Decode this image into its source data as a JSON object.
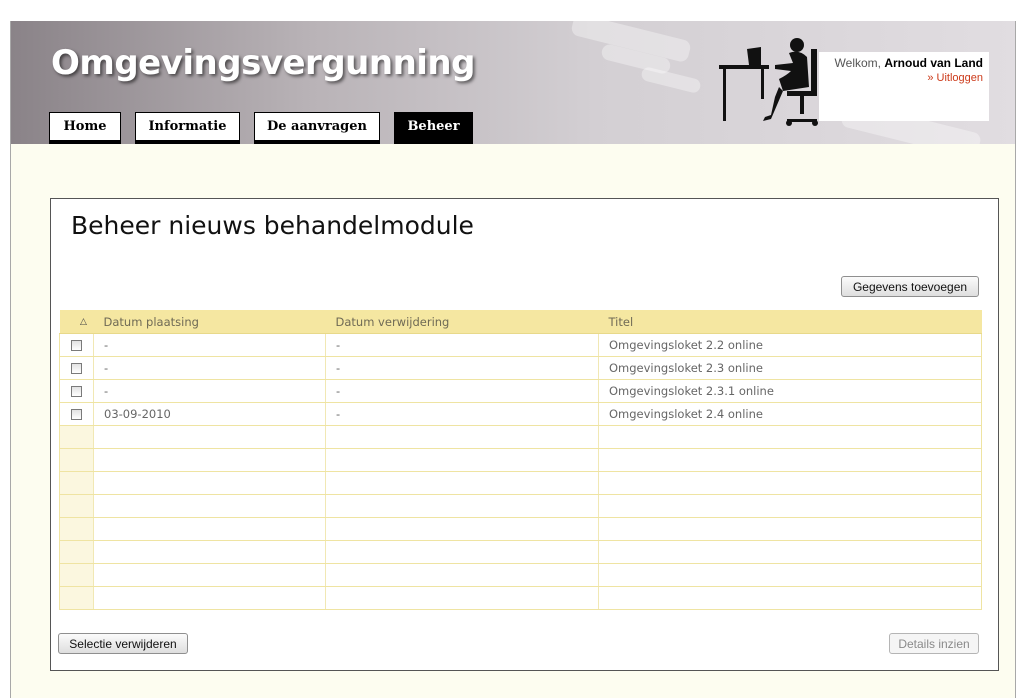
{
  "app": {
    "title": "Omgevingsvergunning"
  },
  "nav": {
    "tabs": [
      {
        "label": "Home"
      },
      {
        "label": "Informatie"
      },
      {
        "label": "De aanvragen"
      },
      {
        "label": "Beheer"
      }
    ],
    "active_tab": "Beheer"
  },
  "user": {
    "greeting": "Welkom,",
    "name": "Arnoud van Land",
    "logout_label": "» Uitloggen"
  },
  "page": {
    "title": "Beheer nieuws behandelmodule",
    "add_button": "Gegevens toevoegen",
    "delete_button": "Selectie verwijderen",
    "details_button": "Details inzien"
  },
  "table": {
    "sort_indicator": "△",
    "columns": [
      "Datum plaatsing",
      "Datum verwijdering",
      "Titel"
    ],
    "rows": [
      {
        "plaatsing": "-",
        "verwijdering": "-",
        "titel": "Omgevingsloket 2.2 online"
      },
      {
        "plaatsing": "-",
        "verwijdering": "-",
        "titel": "Omgevingsloket 2.3 online"
      },
      {
        "plaatsing": "-",
        "verwijdering": "-",
        "titel": "Omgevingsloket 2.3.1 online"
      },
      {
        "plaatsing": "03-09-2010",
        "verwijdering": "-",
        "titel": "Omgevingsloket 2.4 online"
      }
    ]
  },
  "colors": {
    "header_bg": "#b9b3b7",
    "content_bg": "#fdfdf0",
    "table_header_bg": "#f5e7a1",
    "table_row_border": "#efe4a2",
    "logout_link": "#cc3a1a",
    "active_tab_bg": "#000000"
  },
  "icons": {
    "header_illustration": "person-at-desk-silhouette-icon",
    "row_select": "checkbox-icon",
    "sort": "sort-ascending-icon"
  }
}
